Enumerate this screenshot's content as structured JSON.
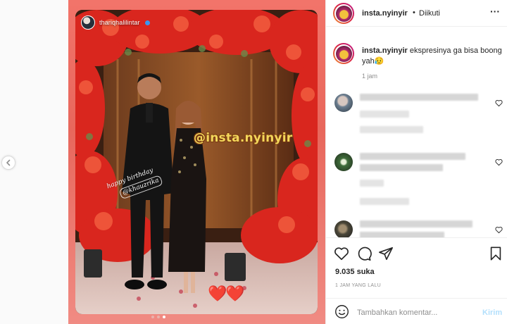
{
  "post": {
    "username": "insta.nyinyir",
    "follow_separator": "•",
    "follow_label": "Diikuti",
    "more_icon": "more-options-icon",
    "caption_user": "insta.nyinyir",
    "caption_text": " ekspresinya ga bisa boong yah😥",
    "caption_time": "1 jam",
    "likes": "9.035 suka",
    "posted_ago": "1 JAM YANG LALU",
    "comment_placeholder": "Tambahkan komentar...",
    "post_button": "Kirim"
  },
  "story": {
    "handle": "thariqhalilintar",
    "watermark": "@insta.nyinyir",
    "birthday_line": "happy birthday",
    "birthday_tag": "@khauzrika",
    "hearts": "❤️❤️"
  },
  "carousel": {
    "total": 3,
    "active": 3
  },
  "colors": {
    "media_background": "#e8675c",
    "watermark": "#f3d75b",
    "link_blue": "#3897f0",
    "post_button_disabled": "#b2dffc"
  },
  "icons": [
    "chevron-left-icon",
    "mute-icon",
    "heart-icon",
    "comment-icon",
    "share-icon",
    "bookmark-icon",
    "emoji-icon",
    "like-comment-icon"
  ]
}
